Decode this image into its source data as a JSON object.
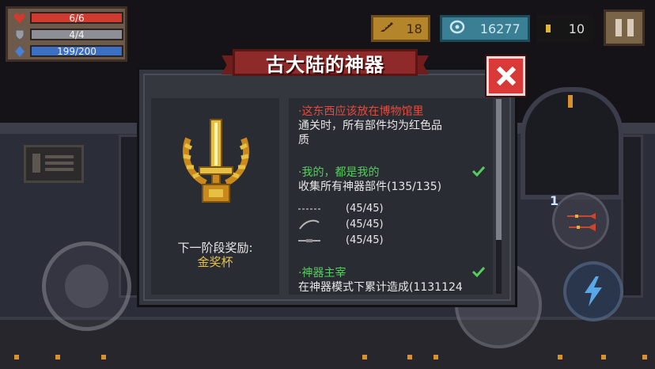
{
  "hud": {
    "hp": {
      "label": "6/6",
      "fraction": 1.0,
      "color": "#d13b2f"
    },
    "armor": {
      "label": "4/4",
      "fraction": 1.0,
      "color": "#8e8e96"
    },
    "energy": {
      "label": "199/200",
      "fraction": 0.995,
      "color": "#3a6fc4"
    },
    "materials_count": "18",
    "gems_count": "16277",
    "coins_count": "10",
    "weapon_slot_number": "1"
  },
  "dialog": {
    "title": "古大陆的神器",
    "next_stage_label": "下一阶段奖励:",
    "next_stage_reward": "金奖杯",
    "achievements": [
      {
        "title": "·这东西应该放在博物馆里",
        "description_line1": "通关时，所有部件均为红色品",
        "description_line2": "质",
        "completed": false
      },
      {
        "title": "·我的，都是我的",
        "description_line1": "收集所有神器部件(135/135)",
        "completed": true,
        "parts": [
          {
            "icon": "bow-string-part-icon",
            "value": "(45/45)"
          },
          {
            "icon": "bow-limb-part-icon",
            "value": "(45/45)"
          },
          {
            "icon": "bow-grip-part-icon",
            "value": "(45/45)"
          }
        ]
      },
      {
        "title": "·神器主宰",
        "description_line1": "在神器模式下累计造成(1131124",
        "completed": true
      }
    ]
  },
  "colors": {
    "title_red": "#8f2a2a",
    "completed_green": "#52d15a",
    "incomplete_red": "#e34b3c",
    "reward_gold": "#e5c043"
  }
}
